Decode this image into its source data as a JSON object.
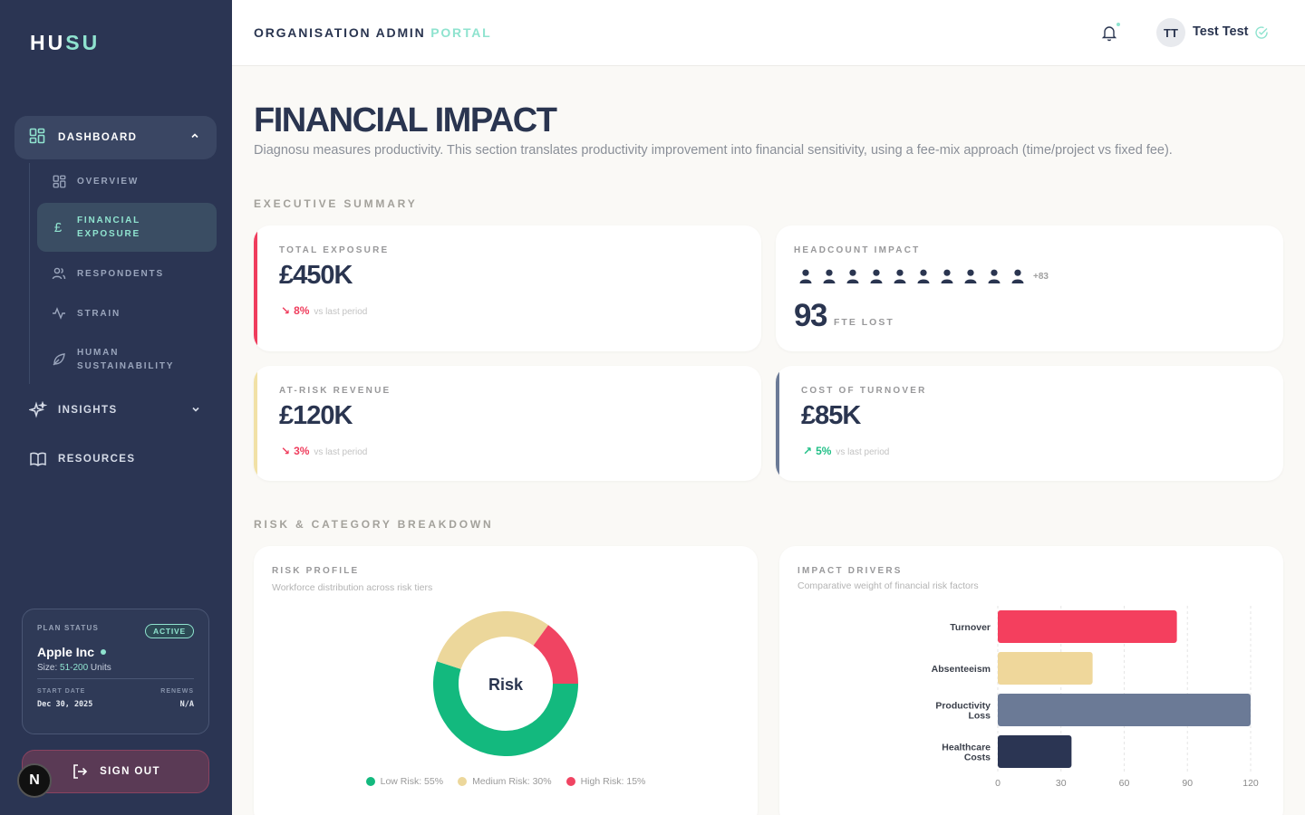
{
  "sidebar": {
    "logo_main": "HU",
    "logo_accent": "SU",
    "dashboard_label": "DASHBOARD",
    "subitems": [
      {
        "label": "OVERVIEW"
      },
      {
        "label": "FINANCIAL EXPOSURE"
      },
      {
        "label": "RESPONDENTS"
      },
      {
        "label": "STRAIN"
      },
      {
        "label": "HUMAN SUSTAINABILITY"
      }
    ],
    "insights_label": "INSIGHTS",
    "resources_label": "RESOURCES",
    "plan": {
      "label": "PLAN STATUS",
      "badge": "ACTIVE",
      "org_name": "Apple Inc",
      "size_prefix": "Size: ",
      "size_value": "51-200",
      "size_suffix": " Units",
      "start_label": "START DATE",
      "start_value": "Dec 30, 2025",
      "renews_label": "RENEWS",
      "renews_value": "N/A"
    },
    "signout_label": "SIGN OUT",
    "next_badge": "N"
  },
  "header": {
    "title_main": "ORGANISATION ADMIN",
    "title_accent": "PORTAL",
    "avatar_initials": "TT",
    "username": "Test Test"
  },
  "page": {
    "title": "FINANCIAL IMPACT",
    "description": "Diagnosu measures productivity. This section translates productivity improvement into financial sensitivity, using a fee-mix approach (time/project vs fixed fee).",
    "exec_heading": "EXECUTIVE SUMMARY",
    "risk_heading": "RISK & CATEGORY BREAKDOWN"
  },
  "kpis": {
    "total_exposure": {
      "label": "TOTAL EXPOSURE",
      "value": "£450K",
      "delta": "8%",
      "compare": "vs last period",
      "direction": "down",
      "accent": "#ef3d5d"
    },
    "headcount": {
      "label": "HEADCOUNT IMPACT",
      "more": "+83",
      "value": "93",
      "unit": "FTE LOST"
    },
    "at_risk": {
      "label": "AT-RISK REVENUE",
      "value": "£120K",
      "delta": "3%",
      "compare": "vs last period",
      "direction": "down",
      "accent": "#f1e1a6"
    },
    "turnover": {
      "label": "COST OF TURNOVER",
      "value": "£85K",
      "delta": "5%",
      "compare": "vs last period",
      "direction": "up",
      "accent": "#6b7a96"
    }
  },
  "risk_profile": {
    "title": "RISK PROFILE",
    "subtitle": "Workforce distribution across risk tiers",
    "center_label": "Risk",
    "legend": [
      "Low Risk: 55%",
      "Medium Risk: 30%",
      "High Risk: 15%"
    ]
  },
  "impact_drivers": {
    "title": "IMPACT DRIVERS",
    "subtitle": "Comparative weight of financial risk factors"
  },
  "chart_data": [
    {
      "type": "pie",
      "title": "RISK PROFILE",
      "categories": [
        "Low Risk",
        "Medium Risk",
        "High Risk"
      ],
      "values": [
        55,
        30,
        15
      ],
      "colors": [
        "#13b97e",
        "#ecd79b",
        "#f04462"
      ],
      "donut": true
    },
    {
      "type": "bar",
      "orientation": "horizontal",
      "title": "IMPACT DRIVERS",
      "categories": [
        "Turnover",
        "Absenteeism",
        "Productivity Loss",
        "Healthcare Costs"
      ],
      "category_lines": [
        [
          "Turnover"
        ],
        [
          "Absenteeism"
        ],
        [
          "Productivity",
          "Loss"
        ],
        [
          "Healthcare",
          "Costs"
        ]
      ],
      "values": [
        85,
        45,
        120,
        35
      ],
      "colors": [
        "#f43f5e",
        "#efd79b",
        "#6b7a96",
        "#2b3553"
      ],
      "xlim": [
        0,
        120
      ],
      "xticks": [
        "0",
        "30",
        "60",
        "90",
        "120"
      ],
      "grid": true
    }
  ]
}
